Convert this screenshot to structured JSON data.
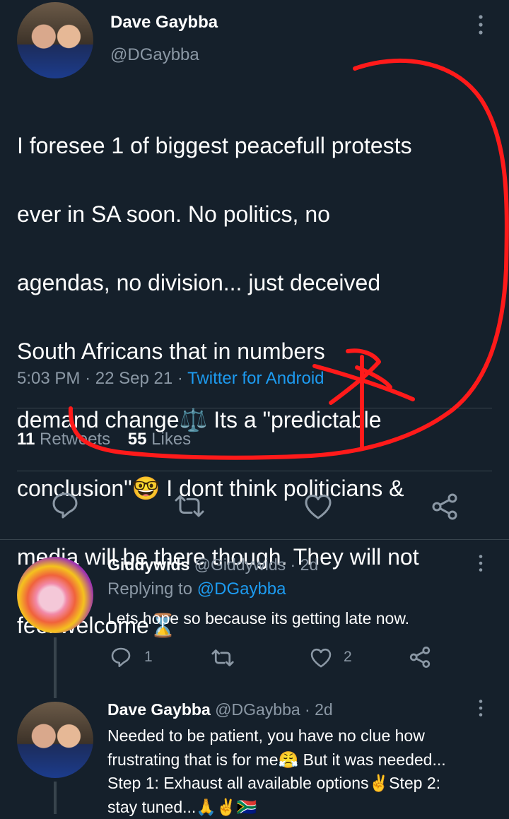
{
  "main_tweet": {
    "author_name": "Dave Gaybba",
    "author_handle": "@DGaybba",
    "text_lines": [
      "I foresee 1 of biggest peacefull protests",
      "ever in SA soon. No politics, no",
      "agendas, no division... just deceived",
      "South Africans that in numbers",
      "demand change⚖️  Its a \"predictable",
      "conclusion\"🤓 I dont think politicians &",
      "media will be there though. They will not",
      "feel welcome⌛"
    ],
    "time": "5:03 PM",
    "date": "22 Sep 21",
    "source": "Twitter for Android",
    "sep": "·",
    "retweets_count": "11",
    "retweets_label": "Retweets",
    "likes_count": "55",
    "likes_label": "Likes"
  },
  "replies": [
    {
      "author_name": "Giddywids",
      "author_handle": "@Giddywids",
      "age": "· 2d",
      "replying_prefix": "Replying to",
      "replying_handle": "@DGaybba",
      "text": "Lets hope so because its getting late now.",
      "reply_count": "1",
      "like_count": "2"
    },
    {
      "author_name": "Dave Gaybba",
      "author_handle": "@DGaybba",
      "age": "· 2d",
      "text_lines": [
        "Needed to be patient, you have no clue how",
        "frustrating that is for me😤 But it was needed...",
        "Step 1: Exhaust all available options✌️Step 2:",
        "stay tuned...🙏✌️🇿🇦"
      ]
    }
  ],
  "colors": {
    "background": "#15202b",
    "text": "#ffffff",
    "muted": "#8b98a5",
    "link": "#1d9bf0",
    "divider": "#38444d",
    "annotation_red": "#ff1a1a"
  }
}
